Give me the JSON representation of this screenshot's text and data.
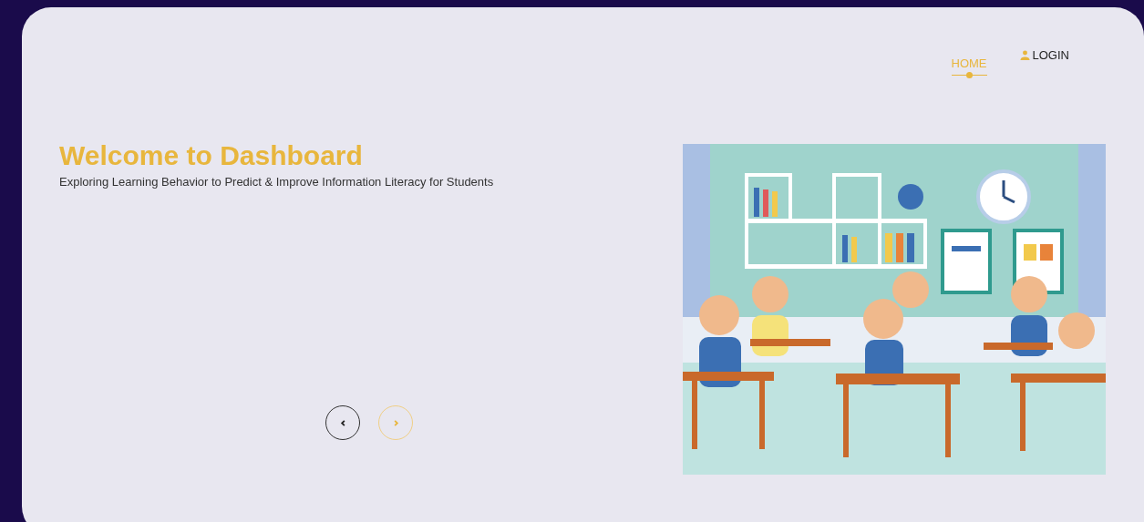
{
  "nav": [
    {
      "label": "HOME",
      "kind": "link",
      "selected": true
    },
    {
      "label": "LOGIN",
      "kind": "user",
      "selected": false
    }
  ],
  "hero": {
    "title": "Welcome to Dashboard",
    "subtitle": "Exploring Learning Behavior to Predict & Improve Information Literacy for Students"
  },
  "carousel_buttons": [
    {
      "kind": "prev",
      "highlighted": false
    },
    {
      "kind": "next",
      "highlighted": true
    }
  ]
}
